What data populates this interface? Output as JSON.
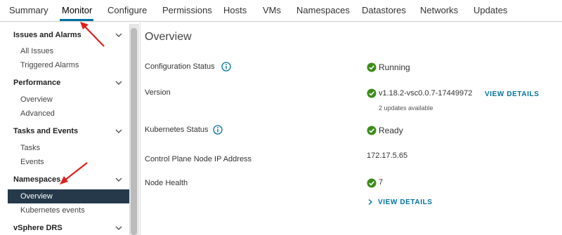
{
  "tabs": [
    "Summary",
    "Monitor",
    "Configure",
    "Permissions",
    "Hosts",
    "VMs",
    "Namespaces",
    "Datastores",
    "Networks",
    "Updates"
  ],
  "active_tab": "Monitor",
  "sidebar": {
    "groups": [
      {
        "label": "Issues and Alarms",
        "items": [
          "All Issues",
          "Triggered Alarms"
        ]
      },
      {
        "label": "Performance",
        "items": [
          "Overview",
          "Advanced"
        ]
      },
      {
        "label": "Tasks and Events",
        "items": [
          "Tasks",
          "Events"
        ]
      },
      {
        "label": "Namespaces",
        "items": [
          "Overview",
          "Kubernetes events"
        ]
      },
      {
        "label": "vSphere DRS",
        "items": []
      }
    ],
    "selected": "Namespaces > Overview"
  },
  "main": {
    "title": "Overview",
    "rows": {
      "config_status": {
        "label": "Configuration Status",
        "value": "Running"
      },
      "version": {
        "label": "Version",
        "value": "v1.18.2-vsc0.0.7-17449972",
        "link": "VIEW DETAILS",
        "subtext": "2 updates available"
      },
      "k8s_status": {
        "label": "Kubernetes Status",
        "value": "Ready"
      },
      "cp_ip": {
        "label": "Control Plane Node IP Address",
        "value": "172.17.5.65"
      },
      "node_health": {
        "label": "Node Health",
        "value": "7",
        "link": "VIEW DETAILS"
      }
    }
  },
  "colors": {
    "accent": "#0072a3",
    "success": "#3c8c1a",
    "selected_bg": "#25394a",
    "annotation": "#e0201b"
  }
}
